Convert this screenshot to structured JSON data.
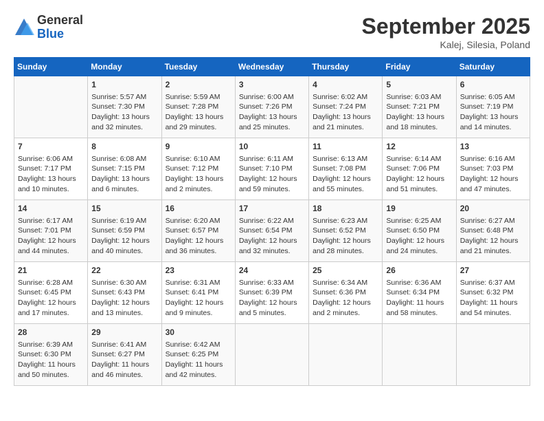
{
  "header": {
    "logo_general": "General",
    "logo_blue": "Blue",
    "month_title": "September 2025",
    "location": "Kalej, Silesia, Poland"
  },
  "days_of_week": [
    "Sunday",
    "Monday",
    "Tuesday",
    "Wednesday",
    "Thursday",
    "Friday",
    "Saturday"
  ],
  "weeks": [
    [
      {
        "day": "",
        "info": ""
      },
      {
        "day": "1",
        "info": "Sunrise: 5:57 AM\nSunset: 7:30 PM\nDaylight: 13 hours\nand 32 minutes."
      },
      {
        "day": "2",
        "info": "Sunrise: 5:59 AM\nSunset: 7:28 PM\nDaylight: 13 hours\nand 29 minutes."
      },
      {
        "day": "3",
        "info": "Sunrise: 6:00 AM\nSunset: 7:26 PM\nDaylight: 13 hours\nand 25 minutes."
      },
      {
        "day": "4",
        "info": "Sunrise: 6:02 AM\nSunset: 7:24 PM\nDaylight: 13 hours\nand 21 minutes."
      },
      {
        "day": "5",
        "info": "Sunrise: 6:03 AM\nSunset: 7:21 PM\nDaylight: 13 hours\nand 18 minutes."
      },
      {
        "day": "6",
        "info": "Sunrise: 6:05 AM\nSunset: 7:19 PM\nDaylight: 13 hours\nand 14 minutes."
      }
    ],
    [
      {
        "day": "7",
        "info": "Sunrise: 6:06 AM\nSunset: 7:17 PM\nDaylight: 13 hours\nand 10 minutes."
      },
      {
        "day": "8",
        "info": "Sunrise: 6:08 AM\nSunset: 7:15 PM\nDaylight: 13 hours\nand 6 minutes."
      },
      {
        "day": "9",
        "info": "Sunrise: 6:10 AM\nSunset: 7:12 PM\nDaylight: 13 hours\nand 2 minutes."
      },
      {
        "day": "10",
        "info": "Sunrise: 6:11 AM\nSunset: 7:10 PM\nDaylight: 12 hours\nand 59 minutes."
      },
      {
        "day": "11",
        "info": "Sunrise: 6:13 AM\nSunset: 7:08 PM\nDaylight: 12 hours\nand 55 minutes."
      },
      {
        "day": "12",
        "info": "Sunrise: 6:14 AM\nSunset: 7:06 PM\nDaylight: 12 hours\nand 51 minutes."
      },
      {
        "day": "13",
        "info": "Sunrise: 6:16 AM\nSunset: 7:03 PM\nDaylight: 12 hours\nand 47 minutes."
      }
    ],
    [
      {
        "day": "14",
        "info": "Sunrise: 6:17 AM\nSunset: 7:01 PM\nDaylight: 12 hours\nand 44 minutes."
      },
      {
        "day": "15",
        "info": "Sunrise: 6:19 AM\nSunset: 6:59 PM\nDaylight: 12 hours\nand 40 minutes."
      },
      {
        "day": "16",
        "info": "Sunrise: 6:20 AM\nSunset: 6:57 PM\nDaylight: 12 hours\nand 36 minutes."
      },
      {
        "day": "17",
        "info": "Sunrise: 6:22 AM\nSunset: 6:54 PM\nDaylight: 12 hours\nand 32 minutes."
      },
      {
        "day": "18",
        "info": "Sunrise: 6:23 AM\nSunset: 6:52 PM\nDaylight: 12 hours\nand 28 minutes."
      },
      {
        "day": "19",
        "info": "Sunrise: 6:25 AM\nSunset: 6:50 PM\nDaylight: 12 hours\nand 24 minutes."
      },
      {
        "day": "20",
        "info": "Sunrise: 6:27 AM\nSunset: 6:48 PM\nDaylight: 12 hours\nand 21 minutes."
      }
    ],
    [
      {
        "day": "21",
        "info": "Sunrise: 6:28 AM\nSunset: 6:45 PM\nDaylight: 12 hours\nand 17 minutes."
      },
      {
        "day": "22",
        "info": "Sunrise: 6:30 AM\nSunset: 6:43 PM\nDaylight: 12 hours\nand 13 minutes."
      },
      {
        "day": "23",
        "info": "Sunrise: 6:31 AM\nSunset: 6:41 PM\nDaylight: 12 hours\nand 9 minutes."
      },
      {
        "day": "24",
        "info": "Sunrise: 6:33 AM\nSunset: 6:39 PM\nDaylight: 12 hours\nand 5 minutes."
      },
      {
        "day": "25",
        "info": "Sunrise: 6:34 AM\nSunset: 6:36 PM\nDaylight: 12 hours\nand 2 minutes."
      },
      {
        "day": "26",
        "info": "Sunrise: 6:36 AM\nSunset: 6:34 PM\nDaylight: 11 hours\nand 58 minutes."
      },
      {
        "day": "27",
        "info": "Sunrise: 6:37 AM\nSunset: 6:32 PM\nDaylight: 11 hours\nand 54 minutes."
      }
    ],
    [
      {
        "day": "28",
        "info": "Sunrise: 6:39 AM\nSunset: 6:30 PM\nDaylight: 11 hours\nand 50 minutes."
      },
      {
        "day": "29",
        "info": "Sunrise: 6:41 AM\nSunset: 6:27 PM\nDaylight: 11 hours\nand 46 minutes."
      },
      {
        "day": "30",
        "info": "Sunrise: 6:42 AM\nSunset: 6:25 PM\nDaylight: 11 hours\nand 42 minutes."
      },
      {
        "day": "",
        "info": ""
      },
      {
        "day": "",
        "info": ""
      },
      {
        "day": "",
        "info": ""
      },
      {
        "day": "",
        "info": ""
      }
    ]
  ]
}
